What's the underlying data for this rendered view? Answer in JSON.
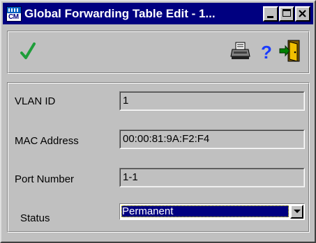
{
  "window": {
    "title": "Global Forwarding Table Edit - 1...",
    "app_icon_text": "CM"
  },
  "toolbar": {
    "icons": [
      "checkmark-icon",
      "printer-icon",
      "help-icon",
      "exit-icon"
    ],
    "help_glyph": "?"
  },
  "form": {
    "vlan_id": {
      "label": "VLAN ID",
      "value": "1"
    },
    "mac_address": {
      "label": "MAC Address",
      "value": "00:00:81:9A:F2:F4"
    },
    "port_number": {
      "label": "Port Number",
      "value": "1-1"
    },
    "status": {
      "label": "Status",
      "value": "Permanent"
    }
  },
  "colors": {
    "titlebar": "#000080",
    "face": "#c0c0c0",
    "check": "#1e9e3a",
    "help": "#1a3cff"
  }
}
